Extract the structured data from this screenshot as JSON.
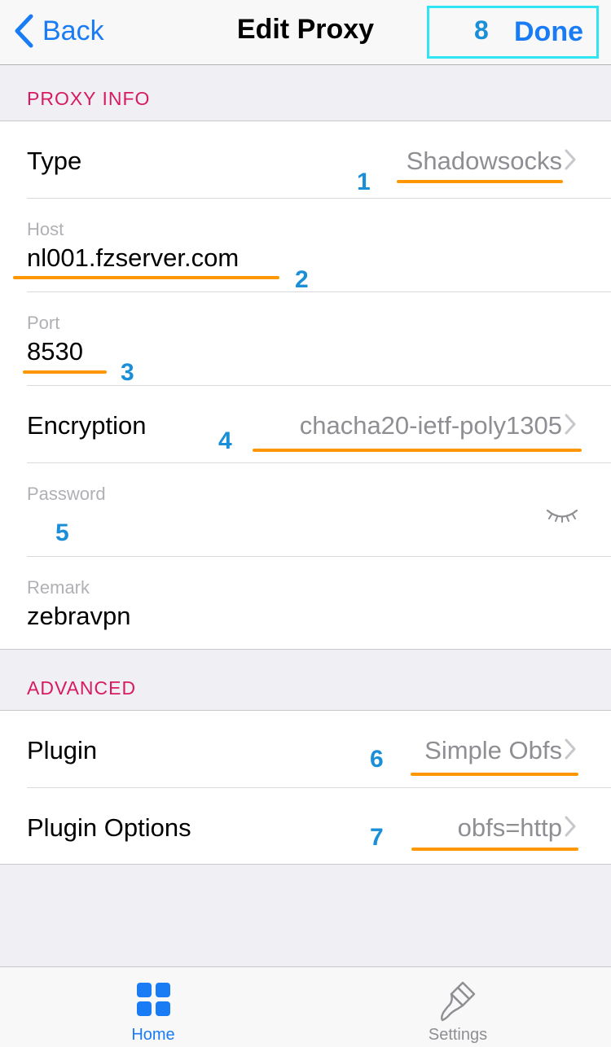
{
  "nav": {
    "back_label": "Back",
    "title": "Edit Proxy",
    "done_label": "Done",
    "done_annotation": "8"
  },
  "proxy_info": {
    "header": "PROXY INFO",
    "type": {
      "label": "Type",
      "value": "Shadowsocks",
      "annotation": "1"
    },
    "host": {
      "label": "Host",
      "value": "nl001.fzserver.com",
      "annotation": "2"
    },
    "port": {
      "label": "Port",
      "value": "8530",
      "annotation": "3"
    },
    "encryption": {
      "label": "Encryption",
      "value": "chacha20-ietf-poly1305",
      "annotation": "4"
    },
    "password": {
      "label": "Password",
      "value": "",
      "annotation": "5"
    },
    "remark": {
      "label": "Remark",
      "value": "zebravpn"
    }
  },
  "advanced": {
    "header": "ADVANCED",
    "plugin": {
      "label": "Plugin",
      "value": "Simple Obfs",
      "annotation": "6"
    },
    "plugin_options": {
      "label": "Plugin Options",
      "value": "obfs=http",
      "annotation": "7"
    }
  },
  "tabbar": {
    "home_label": "Home",
    "settings_label": "Settings"
  },
  "colors": {
    "accent": "#1a7cf5",
    "section_header": "#d81b60",
    "annotation_underline": "#ff9800",
    "annotation_number": "#1a8fd8",
    "highlight_box": "#2ee5f2"
  }
}
